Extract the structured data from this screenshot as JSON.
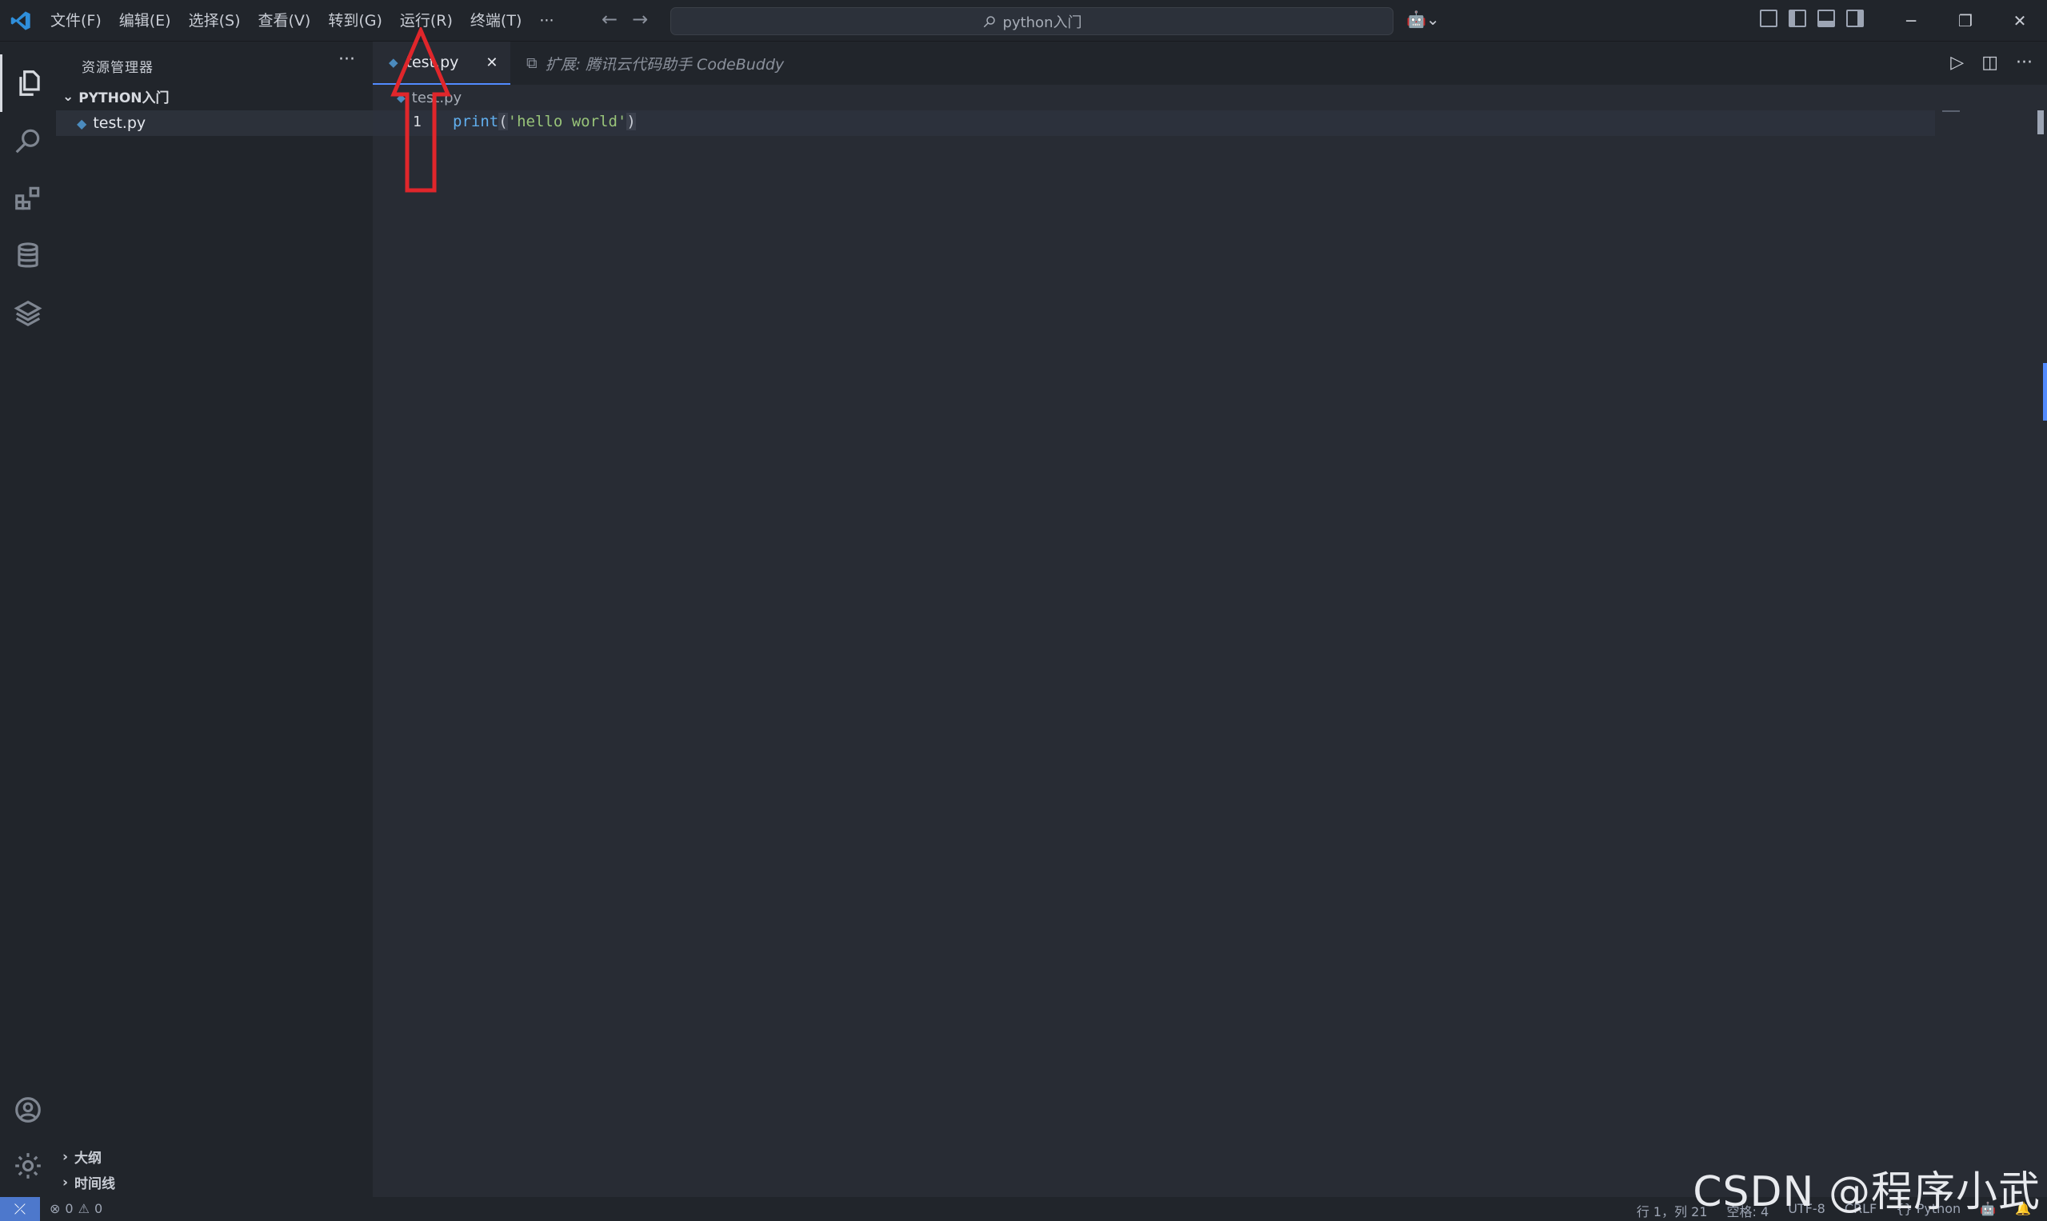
{
  "titlebar": {
    "menus": [
      "文件(F)",
      "编辑(E)",
      "选择(S)",
      "查看(V)",
      "转到(G)",
      "运行(R)",
      "终端(T)",
      "···"
    ],
    "search_text": "python入门",
    "back_icon": "arrow-left-icon",
    "forward_icon": "arrow-right-icon"
  },
  "activity": {
    "items": [
      "explorer-icon",
      "search-icon",
      "extensions-icon",
      "database-icon",
      "layers-icon"
    ],
    "bottom": [
      "account-icon",
      "gear-icon"
    ]
  },
  "sidebar": {
    "title": "资源管理器",
    "more": "···",
    "folder": "PYTHON入门",
    "files": [
      "test.py"
    ],
    "sections": [
      "大纲",
      "时间线"
    ]
  },
  "editor": {
    "tabs": [
      {
        "label": "test.py",
        "active": true
      },
      {
        "label": "扩展: 腾讯云代码助手 CodeBuddy",
        "active": false
      }
    ],
    "breadcrumb": "test.py",
    "line_number": "1",
    "code": {
      "fn": "print",
      "open": "(",
      "str": "'hello world'",
      "close": ")"
    }
  },
  "statusbar": {
    "errors": "0",
    "warnings": "0",
    "position": "行 1，列 21",
    "spaces": "空格: 4",
    "encoding": "UTF-8",
    "eol": "CRLF",
    "language": "{} Python"
  },
  "watermark": "CSDN @程序小武",
  "colors": {
    "accent": "#528bff",
    "annotation": "#e0262b",
    "remote": "#4d78cc"
  }
}
